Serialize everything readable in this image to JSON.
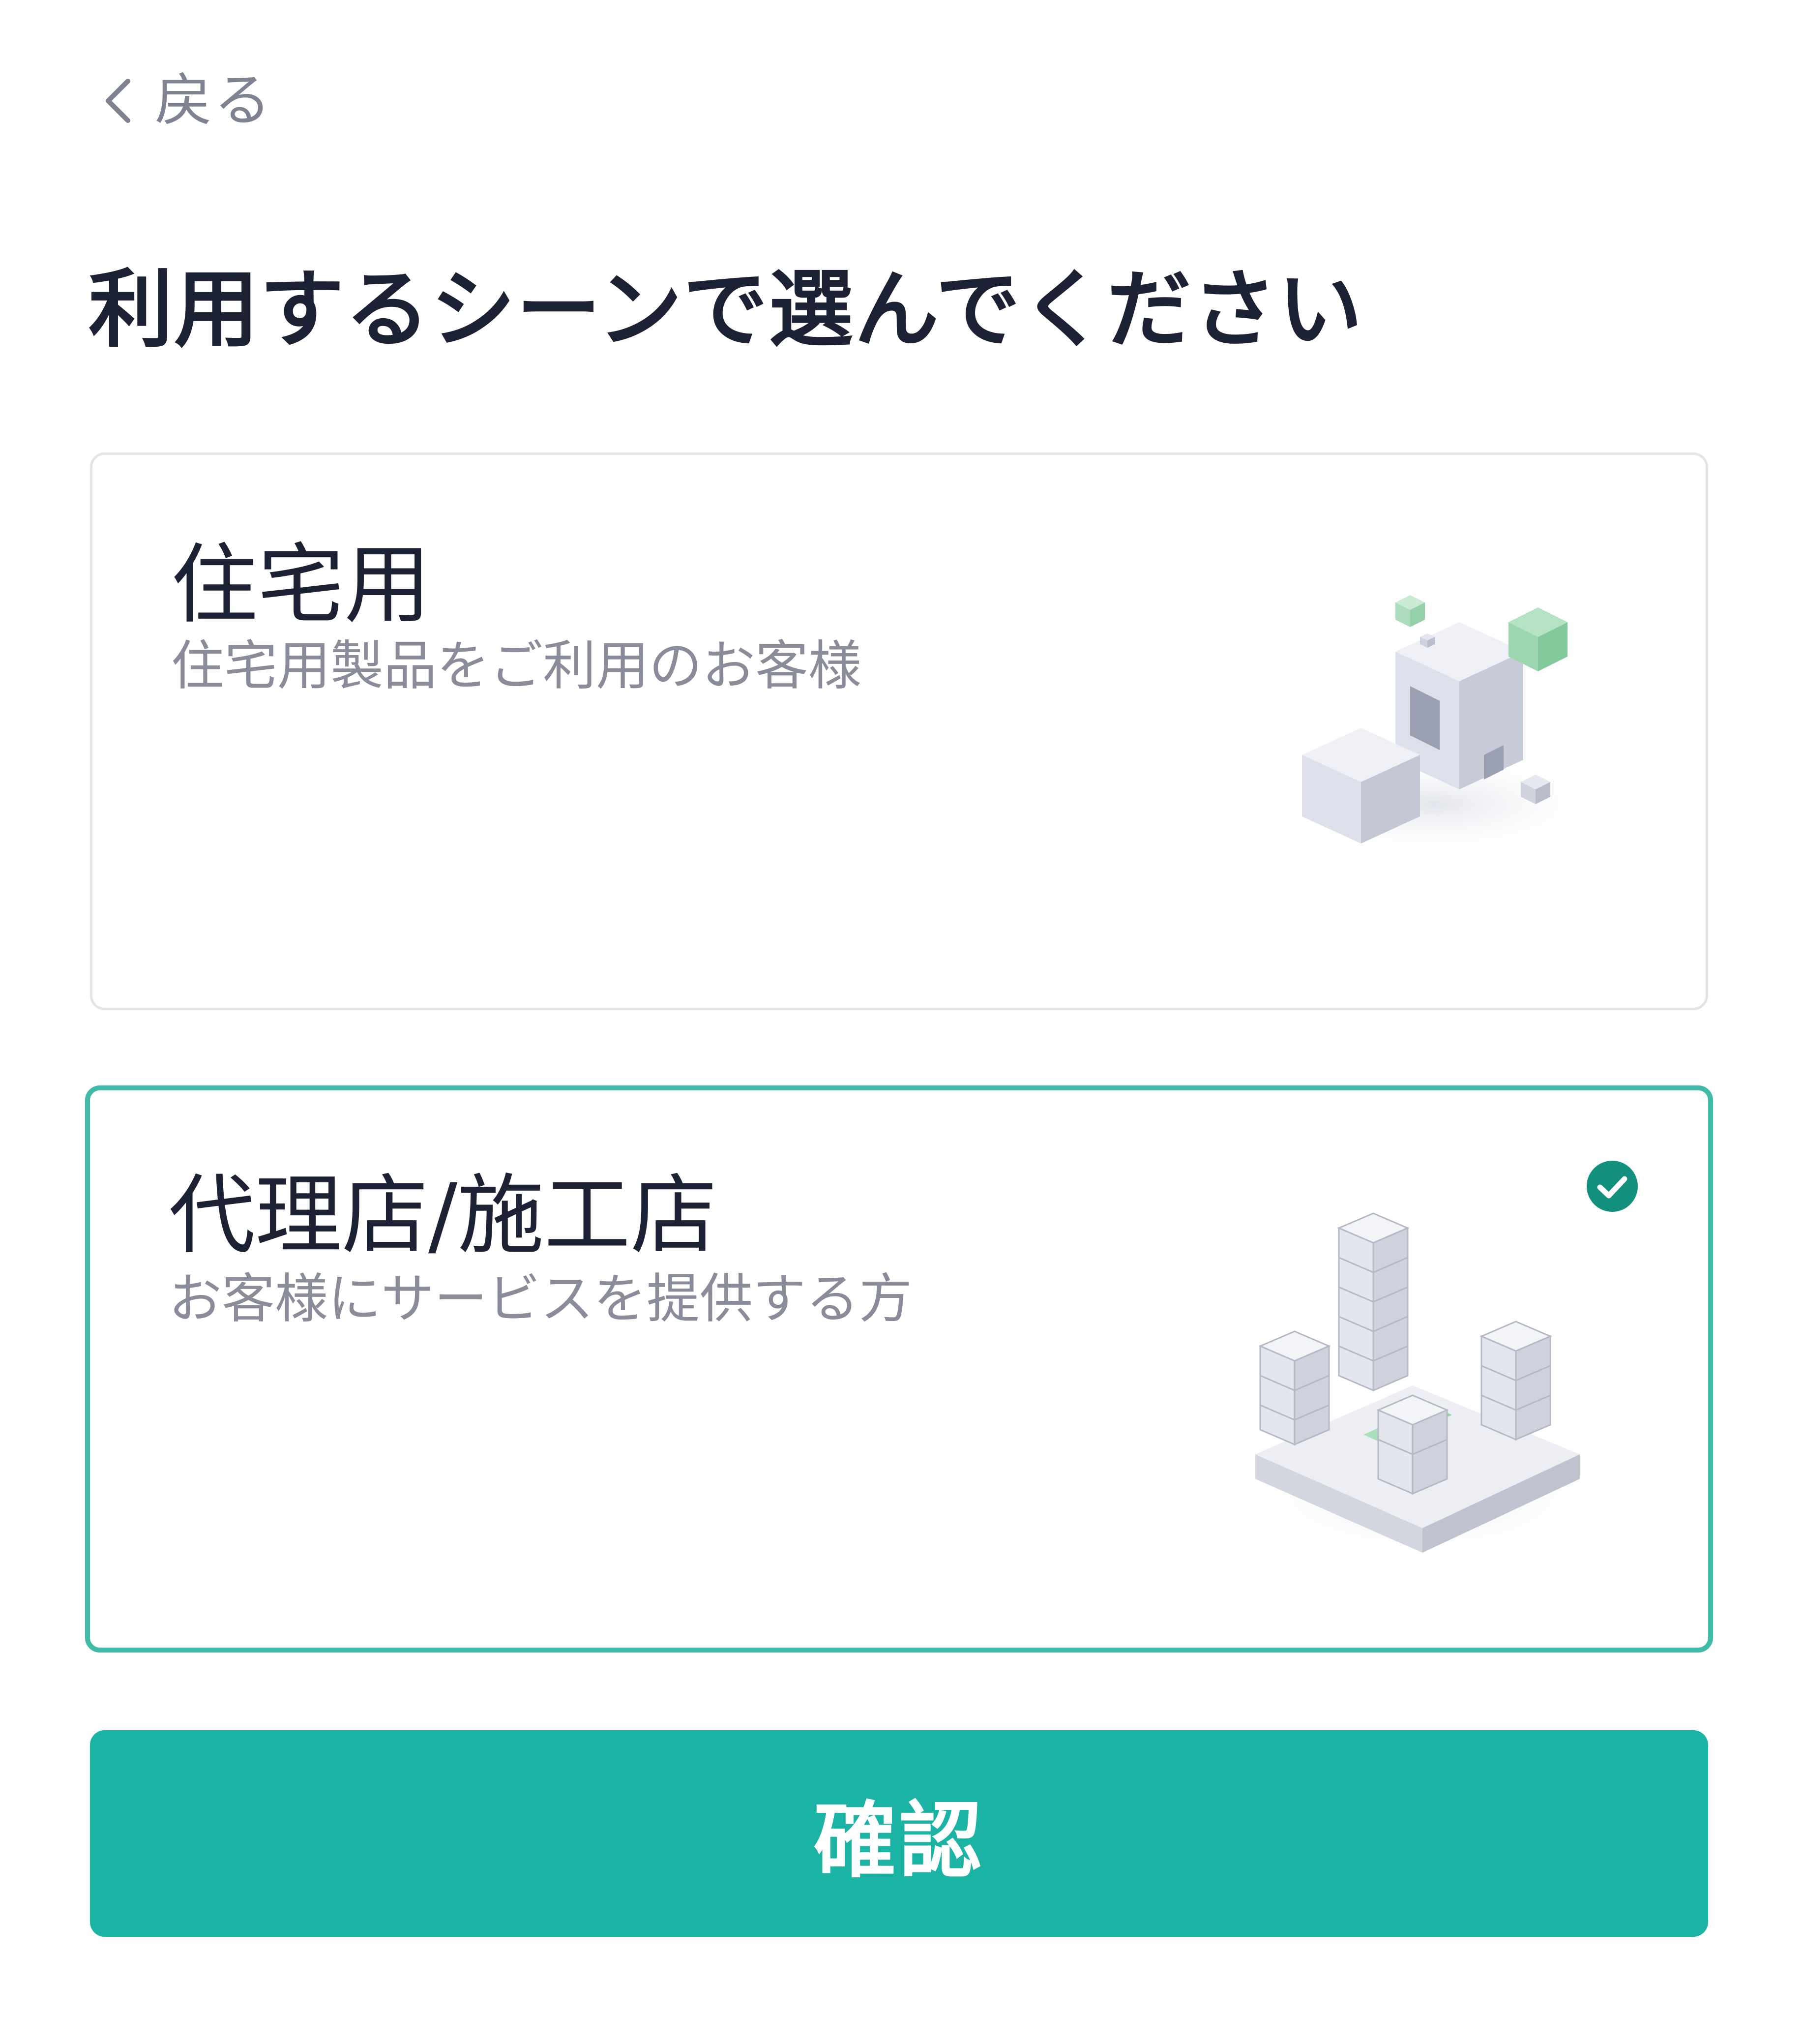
{
  "header": {
    "back_label": "戻る",
    "back_icon": "chevron-left-icon"
  },
  "title": "利用するシーンで選んでください",
  "options": [
    {
      "title": "住宅用",
      "description": "住宅用製品をご利用のお客様",
      "selected": false,
      "illustration": "house-blocks-illustration"
    },
    {
      "title": "代理店/施工店",
      "description": "お客様にサービスを提供する方",
      "selected": true,
      "illustration": "city-blocks-illustration",
      "selected_icon": "check-circle-icon"
    }
  ],
  "confirm_label": "確認",
  "colors": {
    "accent": "#1bb3a3",
    "selected_border": "#3fbba8",
    "title_text": "#1c2233",
    "muted_text": "#8a8c99",
    "card_border": "#e3e4e8",
    "check_bg": "#138f7e",
    "illustration_green": "#8fd4a6"
  }
}
